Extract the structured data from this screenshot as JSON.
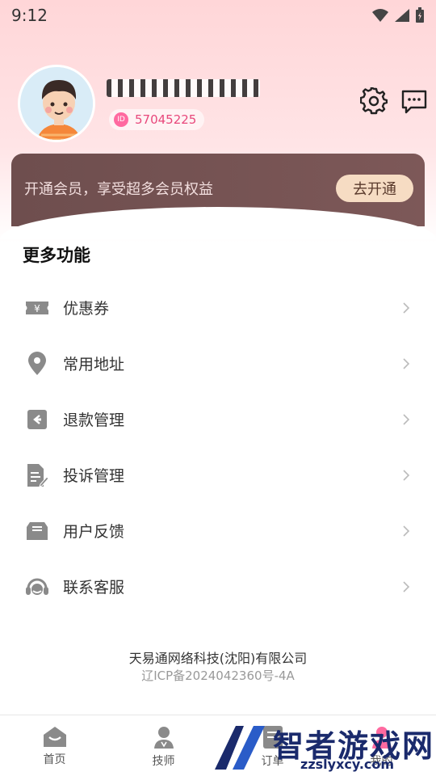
{
  "status_bar": {
    "time": "9:12"
  },
  "profile": {
    "user_id_label": "ID",
    "user_id": "57045225"
  },
  "member": {
    "promo_text": "开通会员，享受超多会员权益",
    "button_label": "去开通"
  },
  "section": {
    "title": "更多功能"
  },
  "menu": {
    "items": [
      {
        "label": "优惠券",
        "icon": "coupon-icon"
      },
      {
        "label": "常用地址",
        "icon": "location-icon"
      },
      {
        "label": "退款管理",
        "icon": "refund-icon"
      },
      {
        "label": "投诉管理",
        "icon": "complaint-icon"
      },
      {
        "label": "用户反馈",
        "icon": "feedback-icon"
      },
      {
        "label": "联系客服",
        "icon": "headset-icon"
      }
    ]
  },
  "footer": {
    "company": "天易通网络科技(沈阳)有限公司",
    "icp": "辽ICP备2024042360号-4A"
  },
  "tabs": [
    {
      "label": "首页",
      "icon": "home-icon"
    },
    {
      "label": "技师",
      "icon": "technician-icon"
    },
    {
      "label": "订单",
      "icon": "order-icon"
    },
    {
      "label": "我的",
      "icon": "profile-icon"
    }
  ],
  "watermark": {
    "text": "智者游戏网",
    "url": "zzslyxcy.com"
  },
  "colors": {
    "accent": "#e8487c",
    "member_card": "#6e4e4e",
    "member_button": "#f6dcc3"
  }
}
